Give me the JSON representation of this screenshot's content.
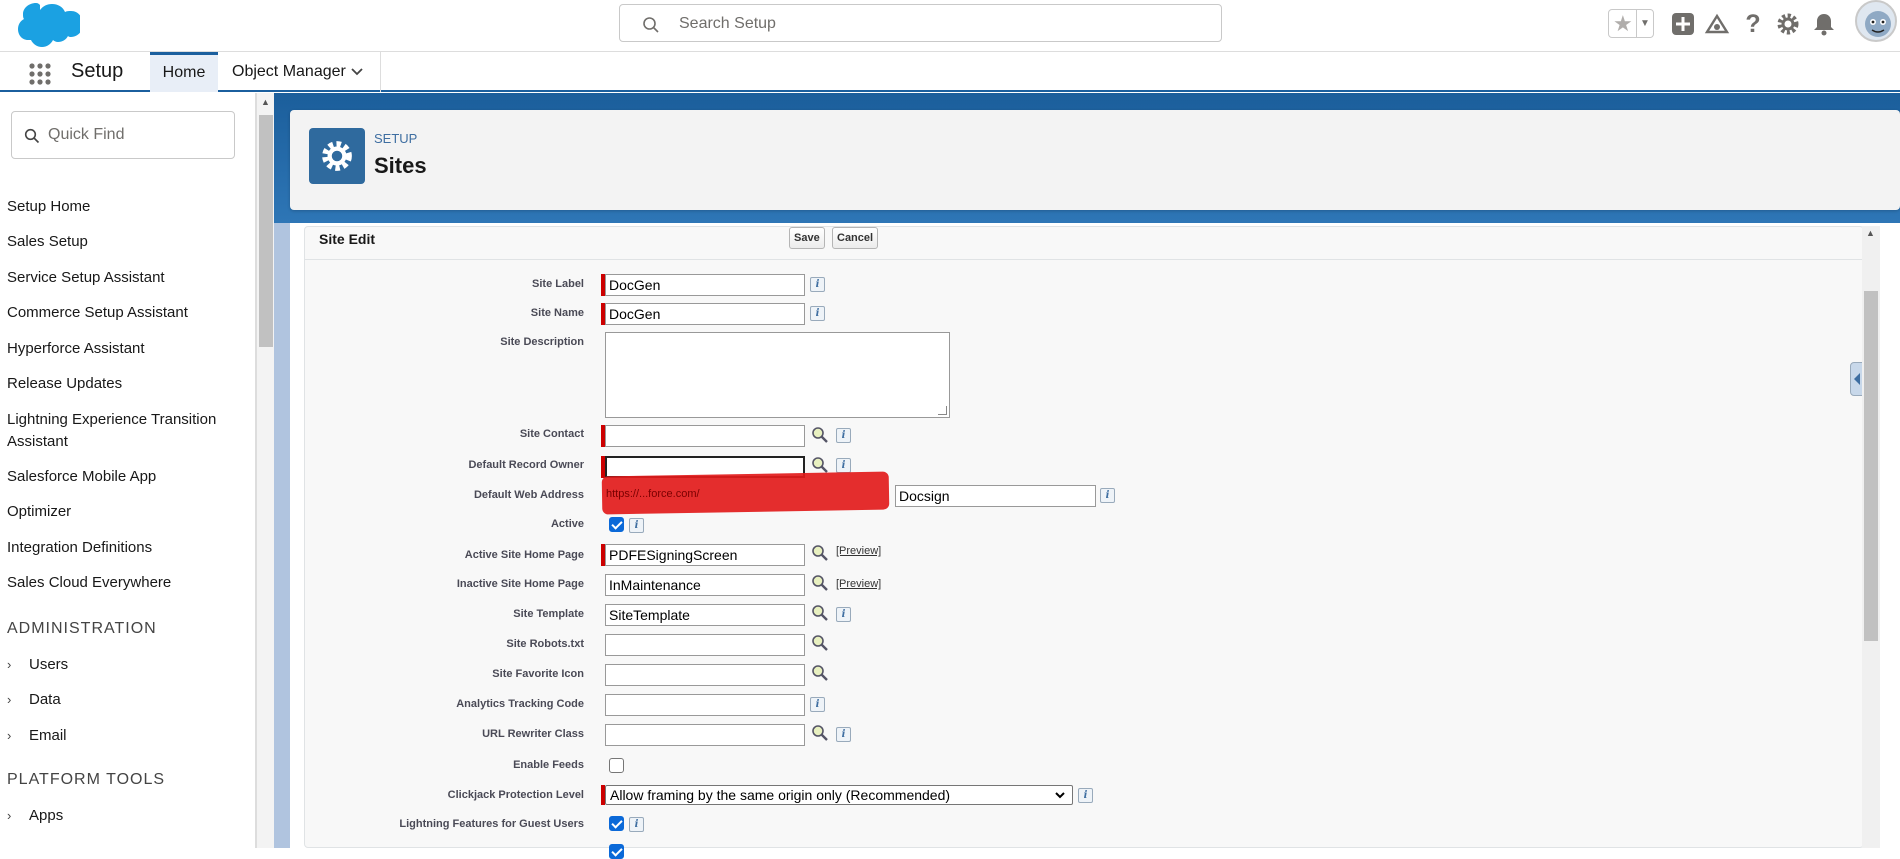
{
  "topbar": {
    "search_placeholder": "Search Setup",
    "icons": [
      "favorites-star-icon",
      "add-icon",
      "trailhead-icon",
      "help-icon",
      "gear-icon",
      "notifications-bell-icon",
      "avatar"
    ]
  },
  "nav": {
    "app_title": "Setup",
    "tabs": [
      {
        "label": "Home"
      },
      {
        "label": "Object Manager"
      }
    ]
  },
  "sidebar": {
    "quickfind_placeholder": "Quick Find",
    "items": [
      {
        "label": "Setup Home"
      },
      {
        "label": "Sales Setup"
      },
      {
        "label": "Service Setup Assistant"
      },
      {
        "label": "Commerce Setup Assistant"
      },
      {
        "label": "Hyperforce Assistant"
      },
      {
        "label": "Release Updates"
      },
      {
        "label": "Lightning Experience Transition Assistant"
      },
      {
        "label": "Salesforce Mobile App"
      },
      {
        "label": "Optimizer"
      },
      {
        "label": "Integration Definitions"
      },
      {
        "label": "Sales Cloud Everywhere"
      }
    ],
    "admin_heading": "ADMINISTRATION",
    "admin_items": [
      {
        "label": "Users"
      },
      {
        "label": "Data"
      },
      {
        "label": "Email"
      }
    ],
    "platform_heading": "PLATFORM TOOLS",
    "platform_items": [
      {
        "label": "Apps"
      }
    ]
  },
  "header": {
    "eyebrow": "SETUP",
    "title": "Sites"
  },
  "form": {
    "title": "Site Edit",
    "save_label": "Save",
    "cancel_label": "Cancel",
    "preview_label": "[Preview]",
    "fields": {
      "site_label": {
        "label": "Site Label",
        "value": "DocGen"
      },
      "site_name": {
        "label": "Site Name",
        "value": "DocGen"
      },
      "site_description": {
        "label": "Site Description",
        "value": ""
      },
      "site_contact": {
        "label": "Site Contact",
        "value": ""
      },
      "default_record_owner": {
        "label": "Default Record Owner",
        "value": ""
      },
      "default_web_address": {
        "label": "Default Web Address",
        "value": "Docsign",
        "prefix_redacted": "https://...force.com/"
      },
      "active": {
        "label": "Active",
        "checked": true
      },
      "active_home": {
        "label": "Active Site Home Page",
        "value": "PDFESigningScreen"
      },
      "inactive_home": {
        "label": "Inactive Site Home Page",
        "value": "InMaintenance"
      },
      "site_template": {
        "label": "Site Template",
        "value": "SiteTemplate"
      },
      "robots": {
        "label": "Site Robots.txt",
        "value": ""
      },
      "favicon": {
        "label": "Site Favorite Icon",
        "value": ""
      },
      "analytics": {
        "label": "Analytics Tracking Code",
        "value": ""
      },
      "url_rewriter": {
        "label": "URL Rewriter Class",
        "value": ""
      },
      "enable_feeds": {
        "label": "Enable Feeds",
        "checked": false
      },
      "clickjack": {
        "label": "Clickjack Protection Level",
        "value": "Allow framing by the same origin only (Recommended)"
      },
      "lightning_guest": {
        "label": "Lightning Features for Guest Users",
        "checked": true
      }
    }
  },
  "colors": {
    "brand": "#1b5f9e",
    "required": "#cc0000",
    "checkbox": "#0b69d8"
  }
}
